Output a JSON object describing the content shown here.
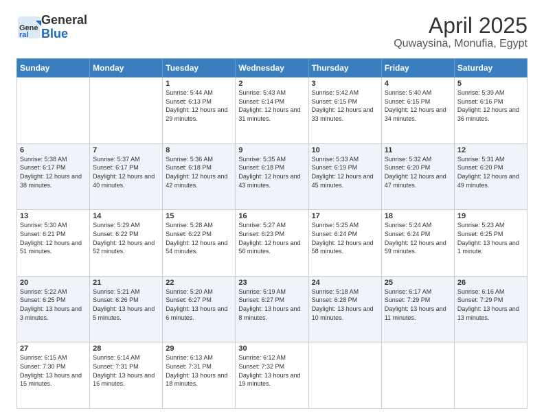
{
  "header": {
    "logo_general": "General",
    "logo_blue": "Blue",
    "title": "April 2025",
    "subtitle": "Quwaysina, Monufia, Egypt"
  },
  "weekdays": [
    "Sunday",
    "Monday",
    "Tuesday",
    "Wednesday",
    "Thursday",
    "Friday",
    "Saturday"
  ],
  "weeks": [
    [
      {
        "day": "",
        "sunrise": "",
        "sunset": "",
        "daylight": ""
      },
      {
        "day": "",
        "sunrise": "",
        "sunset": "",
        "daylight": ""
      },
      {
        "day": "1",
        "sunrise": "Sunrise: 5:44 AM",
        "sunset": "Sunset: 6:13 PM",
        "daylight": "Daylight: 12 hours and 29 minutes."
      },
      {
        "day": "2",
        "sunrise": "Sunrise: 5:43 AM",
        "sunset": "Sunset: 6:14 PM",
        "daylight": "Daylight: 12 hours and 31 minutes."
      },
      {
        "day": "3",
        "sunrise": "Sunrise: 5:42 AM",
        "sunset": "Sunset: 6:15 PM",
        "daylight": "Daylight: 12 hours and 33 minutes."
      },
      {
        "day": "4",
        "sunrise": "Sunrise: 5:40 AM",
        "sunset": "Sunset: 6:15 PM",
        "daylight": "Daylight: 12 hours and 34 minutes."
      },
      {
        "day": "5",
        "sunrise": "Sunrise: 5:39 AM",
        "sunset": "Sunset: 6:16 PM",
        "daylight": "Daylight: 12 hours and 36 minutes."
      }
    ],
    [
      {
        "day": "6",
        "sunrise": "Sunrise: 5:38 AM",
        "sunset": "Sunset: 6:17 PM",
        "daylight": "Daylight: 12 hours and 38 minutes."
      },
      {
        "day": "7",
        "sunrise": "Sunrise: 5:37 AM",
        "sunset": "Sunset: 6:17 PM",
        "daylight": "Daylight: 12 hours and 40 minutes."
      },
      {
        "day": "8",
        "sunrise": "Sunrise: 5:36 AM",
        "sunset": "Sunset: 6:18 PM",
        "daylight": "Daylight: 12 hours and 42 minutes."
      },
      {
        "day": "9",
        "sunrise": "Sunrise: 5:35 AM",
        "sunset": "Sunset: 6:18 PM",
        "daylight": "Daylight: 12 hours and 43 minutes."
      },
      {
        "day": "10",
        "sunrise": "Sunrise: 5:33 AM",
        "sunset": "Sunset: 6:19 PM",
        "daylight": "Daylight: 12 hours and 45 minutes."
      },
      {
        "day": "11",
        "sunrise": "Sunrise: 5:32 AM",
        "sunset": "Sunset: 6:20 PM",
        "daylight": "Daylight: 12 hours and 47 minutes."
      },
      {
        "day": "12",
        "sunrise": "Sunrise: 5:31 AM",
        "sunset": "Sunset: 6:20 PM",
        "daylight": "Daylight: 12 hours and 49 minutes."
      }
    ],
    [
      {
        "day": "13",
        "sunrise": "Sunrise: 5:30 AM",
        "sunset": "Sunset: 6:21 PM",
        "daylight": "Daylight: 12 hours and 51 minutes."
      },
      {
        "day": "14",
        "sunrise": "Sunrise: 5:29 AM",
        "sunset": "Sunset: 6:22 PM",
        "daylight": "Daylight: 12 hours and 52 minutes."
      },
      {
        "day": "15",
        "sunrise": "Sunrise: 5:28 AM",
        "sunset": "Sunset: 6:22 PM",
        "daylight": "Daylight: 12 hours and 54 minutes."
      },
      {
        "day": "16",
        "sunrise": "Sunrise: 5:27 AM",
        "sunset": "Sunset: 6:23 PM",
        "daylight": "Daylight: 12 hours and 56 minutes."
      },
      {
        "day": "17",
        "sunrise": "Sunrise: 5:25 AM",
        "sunset": "Sunset: 6:24 PM",
        "daylight": "Daylight: 12 hours and 58 minutes."
      },
      {
        "day": "18",
        "sunrise": "Sunrise: 5:24 AM",
        "sunset": "Sunset: 6:24 PM",
        "daylight": "Daylight: 12 hours and 59 minutes."
      },
      {
        "day": "19",
        "sunrise": "Sunrise: 5:23 AM",
        "sunset": "Sunset: 6:25 PM",
        "daylight": "Daylight: 13 hours and 1 minute."
      }
    ],
    [
      {
        "day": "20",
        "sunrise": "Sunrise: 5:22 AM",
        "sunset": "Sunset: 6:25 PM",
        "daylight": "Daylight: 13 hours and 3 minutes."
      },
      {
        "day": "21",
        "sunrise": "Sunrise: 5:21 AM",
        "sunset": "Sunset: 6:26 PM",
        "daylight": "Daylight: 13 hours and 5 minutes."
      },
      {
        "day": "22",
        "sunrise": "Sunrise: 5:20 AM",
        "sunset": "Sunset: 6:27 PM",
        "daylight": "Daylight: 13 hours and 6 minutes."
      },
      {
        "day": "23",
        "sunrise": "Sunrise: 5:19 AM",
        "sunset": "Sunset: 6:27 PM",
        "daylight": "Daylight: 13 hours and 8 minutes."
      },
      {
        "day": "24",
        "sunrise": "Sunrise: 5:18 AM",
        "sunset": "Sunset: 6:28 PM",
        "daylight": "Daylight: 13 hours and 10 minutes."
      },
      {
        "day": "25",
        "sunrise": "Sunrise: 6:17 AM",
        "sunset": "Sunset: 7:29 PM",
        "daylight": "Daylight: 13 hours and 11 minutes."
      },
      {
        "day": "26",
        "sunrise": "Sunrise: 6:16 AM",
        "sunset": "Sunset: 7:29 PM",
        "daylight": "Daylight: 13 hours and 13 minutes."
      }
    ],
    [
      {
        "day": "27",
        "sunrise": "Sunrise: 6:15 AM",
        "sunset": "Sunset: 7:30 PM",
        "daylight": "Daylight: 13 hours and 15 minutes."
      },
      {
        "day": "28",
        "sunrise": "Sunrise: 6:14 AM",
        "sunset": "Sunset: 7:31 PM",
        "daylight": "Daylight: 13 hours and 16 minutes."
      },
      {
        "day": "29",
        "sunrise": "Sunrise: 6:13 AM",
        "sunset": "Sunset: 7:31 PM",
        "daylight": "Daylight: 13 hours and 18 minutes."
      },
      {
        "day": "30",
        "sunrise": "Sunrise: 6:12 AM",
        "sunset": "Sunset: 7:32 PM",
        "daylight": "Daylight: 13 hours and 19 minutes."
      },
      {
        "day": "",
        "sunrise": "",
        "sunset": "",
        "daylight": ""
      },
      {
        "day": "",
        "sunrise": "",
        "sunset": "",
        "daylight": ""
      },
      {
        "day": "",
        "sunrise": "",
        "sunset": "",
        "daylight": ""
      }
    ]
  ]
}
